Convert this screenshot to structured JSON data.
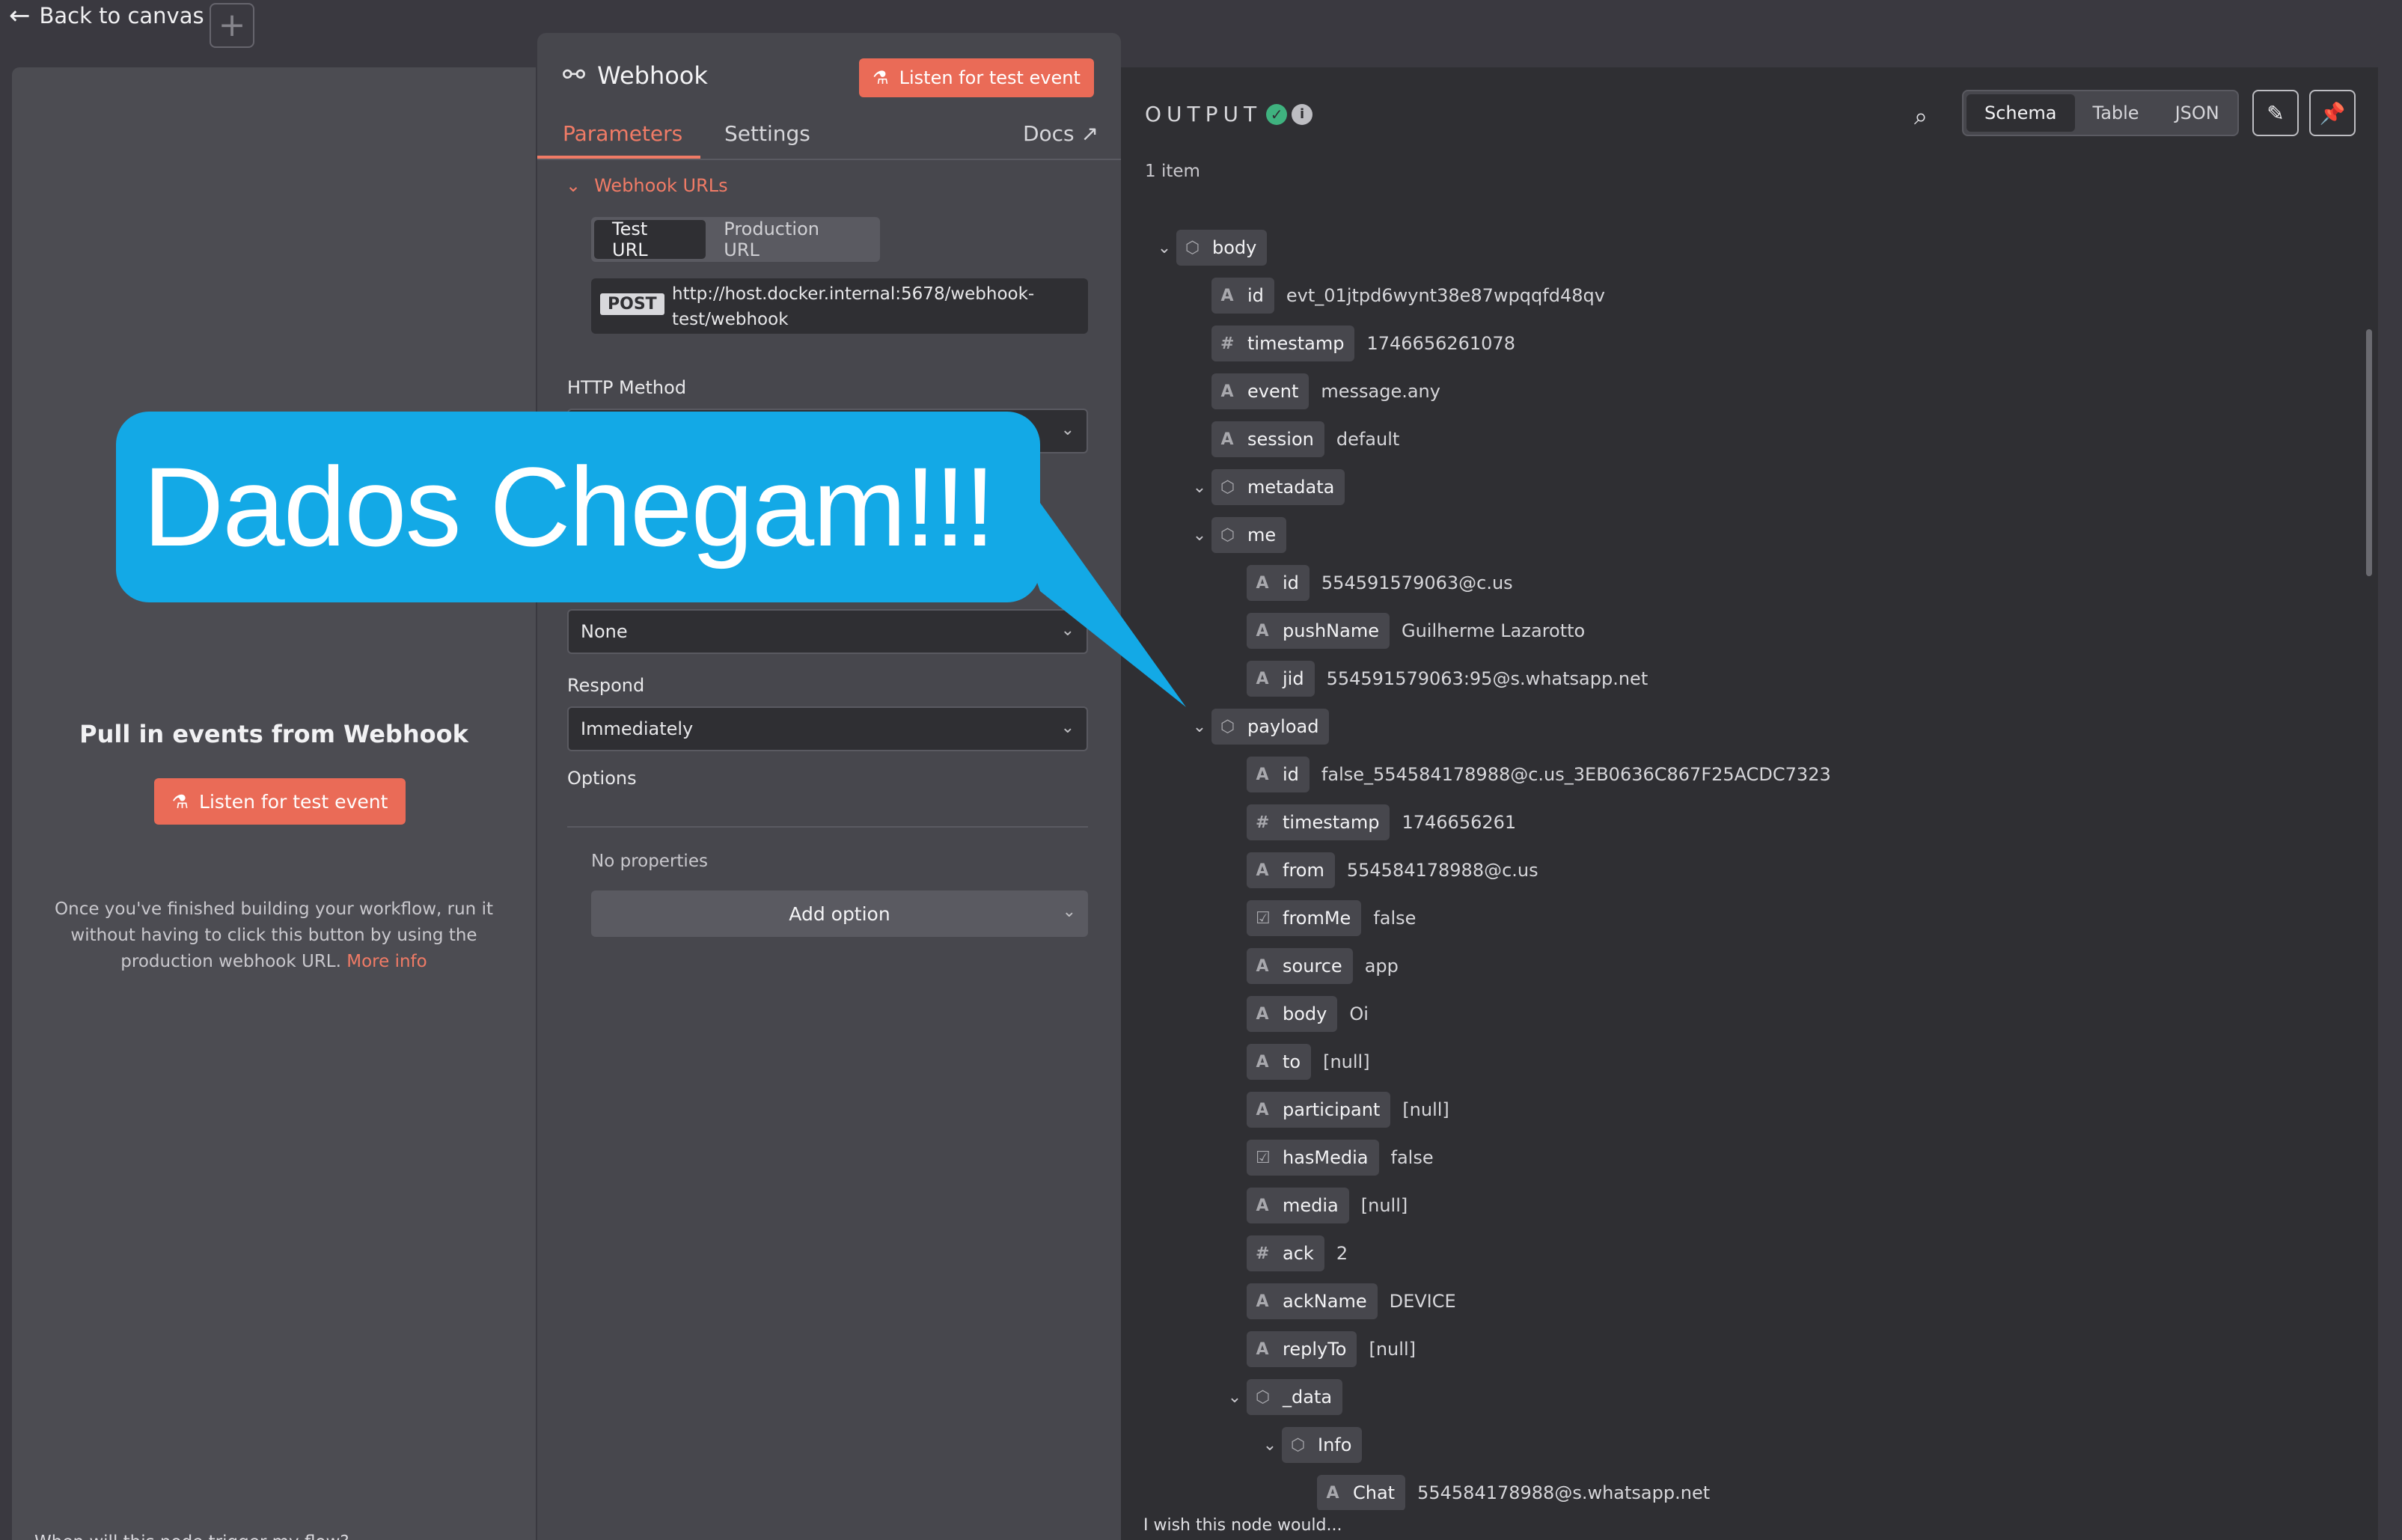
{
  "topbar": {
    "back_label": "Back to canvas",
    "add_label": "+"
  },
  "left_panel": {
    "title": "Pull in events from Webhook",
    "listen_label": "Listen for test event",
    "description": "Once you've finished building your workflow, run it without having to click this button by using the production webhook URL.",
    "more_info": "More info",
    "footer_question": "When will this node trigger my flow?"
  },
  "node": {
    "title": "Webhook",
    "listen_label": "Listen for test event",
    "tabs": [
      "Parameters",
      "Settings"
    ],
    "docs_label": "Docs",
    "webhook_urls_label": "Webhook URLs",
    "url_tabs": [
      "Test URL",
      "Production URL"
    ],
    "method_badge": "POST",
    "url": "http://host.docker.internal:5678/webhook-test/webhook",
    "http_method_label": "HTTP Method",
    "auth_value": "None",
    "respond_label": "Respond",
    "respond_value": "Immediately",
    "options_label": "Options",
    "no_properties": "No properties",
    "add_option": "Add option"
  },
  "output": {
    "title": "OUTPUT",
    "item_count": "1 item",
    "views": [
      "Schema",
      "Table",
      "JSON"
    ],
    "active_view": "Schema",
    "rows": [
      {
        "key": "body",
        "type": "object",
        "value": "",
        "depth": 0,
        "expanded": true
      },
      {
        "key": "id",
        "type": "string",
        "value": "evt_01jtpd6wynt38e87wpqqfd48qv",
        "depth": 1
      },
      {
        "key": "timestamp",
        "type": "number",
        "value": "1746656261078",
        "depth": 1
      },
      {
        "key": "event",
        "type": "string",
        "value": "message.any",
        "depth": 1
      },
      {
        "key": "session",
        "type": "string",
        "value": "default",
        "depth": 1
      },
      {
        "key": "metadata",
        "type": "object",
        "value": "",
        "depth": 1,
        "expanded": true
      },
      {
        "key": "me",
        "type": "object",
        "value": "",
        "depth": 1,
        "expanded": true
      },
      {
        "key": "id",
        "type": "string",
        "value": "554591579063@c.us",
        "depth": 2
      },
      {
        "key": "pushName",
        "type": "string",
        "value": "Guilherme Lazarotto",
        "depth": 2
      },
      {
        "key": "jid",
        "type": "string",
        "value": "554591579063:95@s.whatsapp.net",
        "depth": 2
      },
      {
        "key": "payload",
        "type": "object",
        "value": "",
        "depth": 1,
        "expanded": true
      },
      {
        "key": "id",
        "type": "string",
        "value": "false_554584178988@c.us_3EB0636C867F25ACDC7323",
        "depth": 2
      },
      {
        "key": "timestamp",
        "type": "number",
        "value": "1746656261",
        "depth": 2
      },
      {
        "key": "from",
        "type": "string",
        "value": "554584178988@c.us",
        "depth": 2
      },
      {
        "key": "fromMe",
        "type": "boolean",
        "value": "false",
        "depth": 2
      },
      {
        "key": "source",
        "type": "string",
        "value": "app",
        "depth": 2
      },
      {
        "key": "body",
        "type": "string",
        "value": "Oi",
        "depth": 2
      },
      {
        "key": "to",
        "type": "string",
        "value": "[null]",
        "depth": 2
      },
      {
        "key": "participant",
        "type": "string",
        "value": "[null]",
        "depth": 2
      },
      {
        "key": "hasMedia",
        "type": "boolean",
        "value": "false",
        "depth": 2
      },
      {
        "key": "media",
        "type": "string",
        "value": "[null]",
        "depth": 2
      },
      {
        "key": "ack",
        "type": "number",
        "value": "2",
        "depth": 2
      },
      {
        "key": "ackName",
        "type": "string",
        "value": "DEVICE",
        "depth": 2
      },
      {
        "key": "replyTo",
        "type": "string",
        "value": "[null]",
        "depth": 2
      },
      {
        "key": "_data",
        "type": "object",
        "value": "",
        "depth": 2,
        "expanded": true
      },
      {
        "key": "Info",
        "type": "object",
        "value": "",
        "depth": 3,
        "expanded": true
      },
      {
        "key": "Chat",
        "type": "string",
        "value": "554584178988@s.whatsapp.net",
        "depth": 4
      }
    ],
    "bottom_text": "I wish this node would..."
  },
  "callout": {
    "text": "Dados Chegam!!!",
    "color": "#13a9e6"
  },
  "colors": {
    "accent": "#ea6b57",
    "success": "#3fb27f"
  },
  "icons": {
    "back": "arrow-left-icon",
    "webhook": "webhook-icon",
    "flask": "flask-icon",
    "search": "search-icon",
    "pencil": "pencil-icon",
    "pin": "pin-icon"
  }
}
